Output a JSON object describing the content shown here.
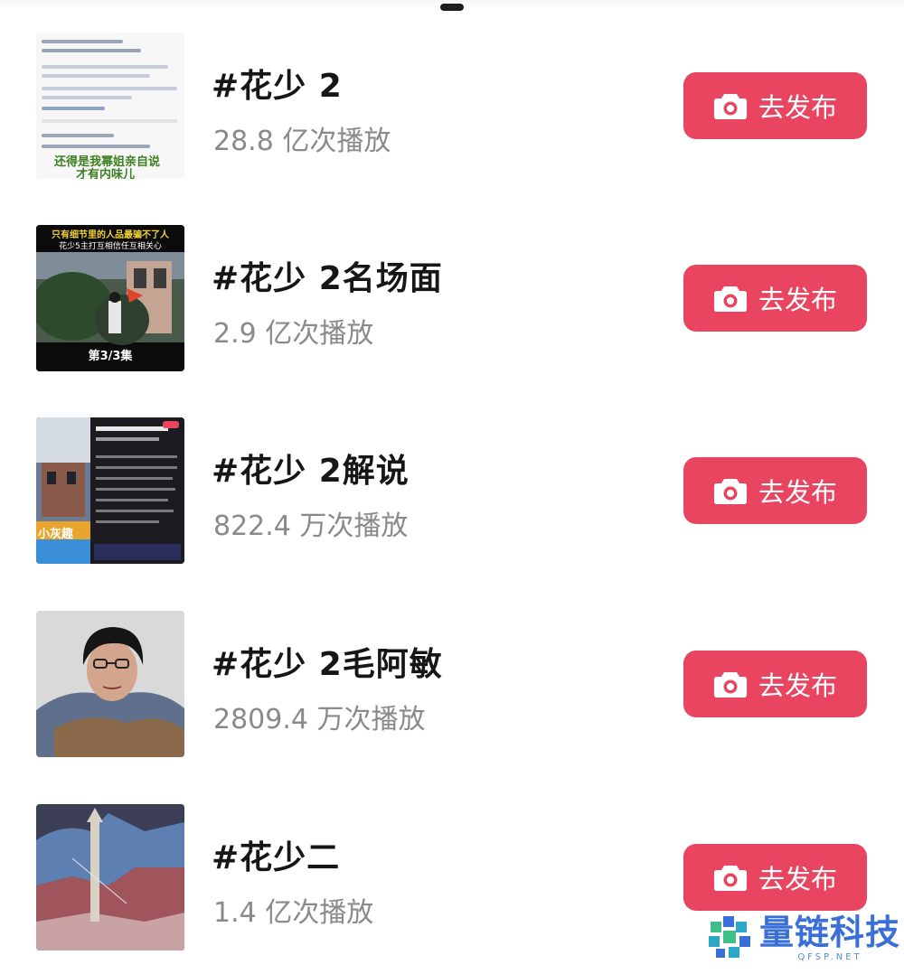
{
  "items": [
    {
      "title": "#花少 2",
      "plays": "28.8 亿次播放",
      "button": "去发布"
    },
    {
      "title": "#花少 2名场面",
      "plays": "2.9 亿次播放",
      "button": "去发布"
    },
    {
      "title": "#花少 2解说",
      "plays": "822.4 万次播放",
      "button": "去发布"
    },
    {
      "title": "#花少 2毛阿敏",
      "plays": "2809.4 万次播放",
      "button": "去发布"
    },
    {
      "title": "#花少二",
      "plays": "1.4 亿次播放",
      "button": "去发布"
    }
  ],
  "thumbs": {
    "t1_caption1": "还得是我幂姐亲自说",
    "t1_caption2": "才有内味儿",
    "t2_top": "只有细节里的人品最骗不了人",
    "t2_sub": "花少5主打互相信任互相关心",
    "t2_ep": "第3/3集",
    "t3_label": "小灰趣"
  },
  "watermark": {
    "name": "量链科技",
    "url": "QFSP.NET"
  },
  "colors": {
    "accent": "#e94560",
    "brand": "#3a6fd8"
  }
}
